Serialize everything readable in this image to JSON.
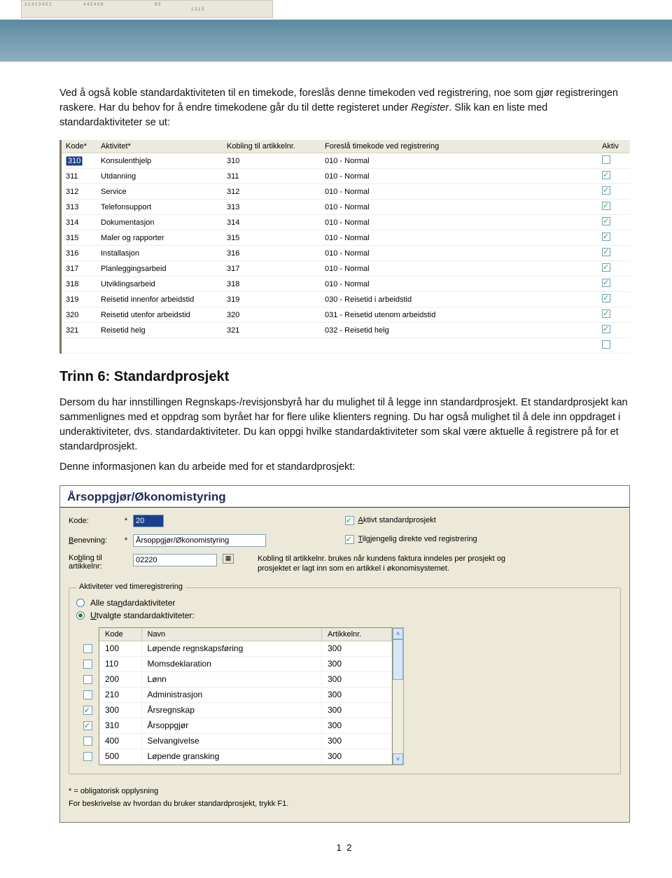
{
  "para1_a": "Ved å også koble standardaktiviteten til en timekode, foreslås denne timekoden ved registrering, noe som gjør registreringen raskere. Har du behov for å endre timekodene går du til dette registeret under ",
  "para1_register": "Register",
  "para1_b": ". Slik kan en liste med standardaktiviteter se ut:",
  "tbl1": {
    "headers": [
      "Kode*",
      "Aktivitet*",
      "Kobling til artikkelnr.",
      "Foreslå timekode ved registrering",
      "Aktiv"
    ],
    "rows": [
      {
        "kode": "310",
        "akt": "Konsulenthjelp",
        "kob": "310",
        "for": "010 - Normal",
        "aktiv": false,
        "sel": true
      },
      {
        "kode": "311",
        "akt": "Utdanning",
        "kob": "311",
        "for": "010 - Normal",
        "aktiv": true
      },
      {
        "kode": "312",
        "akt": "Service",
        "kob": "312",
        "for": "010 - Normal",
        "aktiv": true
      },
      {
        "kode": "313",
        "akt": "Telefonsupport",
        "kob": "313",
        "for": "010 - Normal",
        "aktiv": true
      },
      {
        "kode": "314",
        "akt": "Dokumentasjon",
        "kob": "314",
        "for": "010 - Normal",
        "aktiv": true
      },
      {
        "kode": "315",
        "akt": "Maler og rapporter",
        "kob": "315",
        "for": "010 - Normal",
        "aktiv": true
      },
      {
        "kode": "316",
        "akt": "Installasjon",
        "kob": "316",
        "for": "010 - Normal",
        "aktiv": true
      },
      {
        "kode": "317",
        "akt": "Planleggingsarbeid",
        "kob": "317",
        "for": "010 - Normal",
        "aktiv": true
      },
      {
        "kode": "318",
        "akt": "Utviklingsarbeid",
        "kob": "318",
        "for": "010 - Normal",
        "aktiv": true
      },
      {
        "kode": "319",
        "akt": "Reisetid innenfor arbeidstid",
        "kob": "319",
        "for": "030 - Reisetid i arbeidstid",
        "aktiv": true
      },
      {
        "kode": "320",
        "akt": "Reisetid utenfor arbeidstid",
        "kob": "320",
        "for": "031 - Reisetid utenom arbeidstid",
        "aktiv": true
      },
      {
        "kode": "321",
        "akt": "Reisetid helg",
        "kob": "321",
        "for": "032 - Reisetid helg",
        "aktiv": true
      },
      {
        "kode": "",
        "akt": "",
        "kob": "",
        "for": "",
        "aktiv": false
      }
    ]
  },
  "heading": "Trinn 6: Standardprosjekt",
  "para2": "Dersom du har innstillingen Regnskaps-/revisjonsbyrå har du mulighet til å legge inn standardprosjekt. Et standardprosjekt kan sammenlignes med et oppdrag som byrået har for flere ulike klienters regning. Du har også mulighet til å dele inn oppdraget i underaktiviteter, dvs. standardaktiviteter. Du kan oppgi hvilke standardaktiviteter som skal være aktuelle å registrere på for et standardprosjekt.",
  "para3": "Denne informasjonen kan du arbeide med for et standardprosjekt:",
  "dlg": {
    "title": "Årsoppgjør/Økonomistyring",
    "kode_lbl": "Kode:",
    "kode_val": "20",
    "bene_lbl": "Benevning:",
    "bene_val": "Årsoppgjør/Økonomistyring",
    "kob_lbl_a": "Ko",
    "kob_lbl_b": "bling til artikkelnr:",
    "kob_val": "02220",
    "cb_aktiv_lbl": "Aktivt standardprosjekt",
    "cb_aktiv_u": "A",
    "cb_tilgj_lbl": "ilgjengelig direkte ved registrering",
    "cb_tilgj_u": "T",
    "kob_note": "Kobling til artikkelnr. brukes når kundens faktura inndeles per prosjekt og prosjektet er lagt inn som en artikkel i økonomisystemet.",
    "gb_title": "Aktiviteter ved timeregistrering",
    "radio1_a": "Alle sta",
    "radio1_u": "n",
    "radio1_b": "dardaktiviteter",
    "radio2_u": "U",
    "radio2_b": "tvalgte standardaktiviteter:",
    "grid_headers": [
      "Kode",
      "Navn",
      "Artikkelnr."
    ],
    "grid_rows": [
      {
        "c": false,
        "kode": "100",
        "navn": "Løpende regnskapsføring",
        "art": "300"
      },
      {
        "c": false,
        "kode": "110",
        "navn": "Momsdeklaration",
        "art": "300"
      },
      {
        "c": false,
        "kode": "200",
        "navn": "Lønn",
        "art": "300"
      },
      {
        "c": false,
        "kode": "210",
        "navn": "Administrasjon",
        "art": "300"
      },
      {
        "c": true,
        "kode": "300",
        "navn": "Årsregnskap",
        "art": "300"
      },
      {
        "c": true,
        "kode": "310",
        "navn": "Årsoppgjør",
        "art": "300"
      },
      {
        "c": false,
        "kode": "400",
        "navn": "Selvangivelse",
        "art": "300"
      },
      {
        "c": false,
        "kode": "500",
        "navn": "Løpende gransking",
        "art": "300"
      }
    ],
    "foot1": "* = obligatorisk opplysning",
    "foot2": "For beskrivelse av hvordan du bruker standardprosjekt, trykk F1."
  },
  "pagenum": "1 2"
}
